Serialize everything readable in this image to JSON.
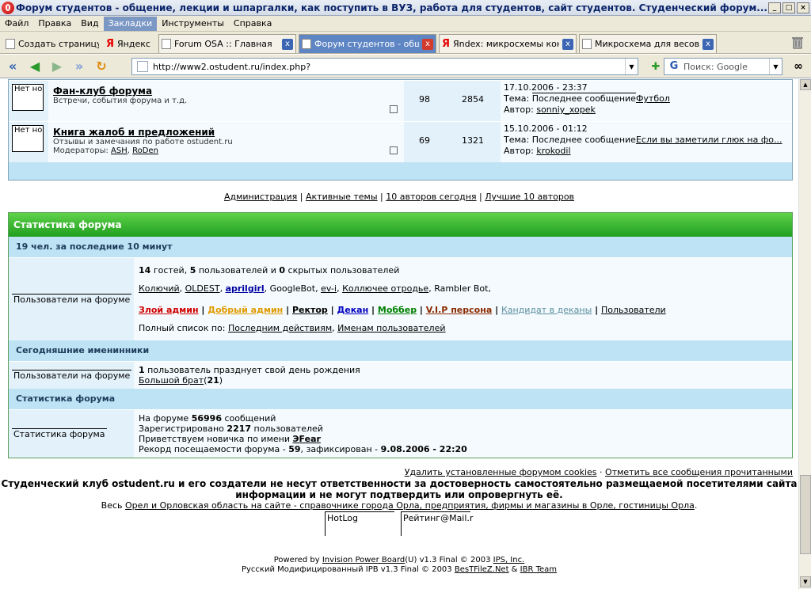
{
  "window": {
    "title": "Форум студентов - общение, лекции и шпаргалки, как поступить в ВУЗ, работа для студентов, сайт студентов. Студенческий форум... - Opera"
  },
  "menu": [
    "Файл",
    "Правка",
    "Вид",
    "Закладки",
    "Инструменты",
    "Справка"
  ],
  "tabs": [
    {
      "label": "Создать страницу",
      "kind": "page"
    },
    {
      "label": "Яндекс",
      "kind": "yandex"
    },
    {
      "label": "Forum OSA :: Главная",
      "kind": "doc"
    },
    {
      "label": "Форум студентов - общ...",
      "kind": "doc",
      "active": true
    },
    {
      "label": "Яndex: микросхемы кон...",
      "kind": "yandex"
    },
    {
      "label": "Микросхема для весов ...",
      "kind": "doc"
    }
  ],
  "address": {
    "url": "http://www2.ostudent.ru/index.php?"
  },
  "search": {
    "placeholder": "Поиск: Google"
  },
  "forums": [
    {
      "no": "Нет но",
      "title": "Фан-клуб форума",
      "desc": "Встречи, события форума и т.д.",
      "mods_label": "",
      "mods": [],
      "topics": "98",
      "posts": "2854",
      "date": "17.10.2006 - 23:37",
      "tema_label": "Тема:",
      "last_label": "Последнее сообщение",
      "topic": "Футбол",
      "author_label": "Автор:",
      "author": "sonniy_xopek"
    },
    {
      "no": "Нет но",
      "title": "Книга жалоб и предложений",
      "desc": "Отзывы и замечания по работе ostudent.ru",
      "mods_label": "Модераторы:",
      "mods": [
        "ASH",
        "RoDen"
      ],
      "topics": "69",
      "posts": "1321",
      "date": "15.10.2006 - 01:12",
      "tema_label": "Тема:",
      "last_label": "Последнее сообщение",
      "topic": "Если вы заметили глюк на фо...",
      "author_label": "Автор:",
      "author": "krokodil"
    }
  ],
  "toplinks": [
    "Администрация",
    "Активные темы",
    "10 авторов сегодня",
    "Лучшие 10 авторов"
  ],
  "stats": {
    "header": "Статистика форума",
    "online_head": "19 чел. за последние 10 минут",
    "online_label": "Пользователи на форуме",
    "guests": "14",
    "guests_t": "гостей,",
    "users": "5",
    "users_t": "пользователей и",
    "hidden": "0",
    "hidden_t": "скрытых пользователей",
    "online_users": [
      "Колючий",
      "OLDEST",
      "aprilgirl",
      "GoogleBot",
      "ev-i",
      "Коллючее отродье",
      "Rambler Bot"
    ],
    "groups": [
      {
        "name": "Злой админ",
        "color": "#d00000"
      },
      {
        "name": "Добрый админ",
        "color": "#e09a00"
      },
      {
        "name": "Ректор",
        "color": "#000000"
      },
      {
        "name": "Декан",
        "color": "#0000c0"
      },
      {
        "name": "Моббер",
        "color": "#008000"
      },
      {
        "name": "V.I.P персона",
        "color": "#8b2a00"
      },
      {
        "name": "Кандидат в деканы",
        "color": "#5a8ea0"
      },
      {
        "name": "Пользователи",
        "color": "#000000"
      }
    ],
    "fulllist": "Полный список по:",
    "by_action": "Последним действиям",
    "by_name": "Именам пользователей",
    "bday_head": "Сегодняшние именинники",
    "bday_label": "Пользователи на форуме",
    "bday_count": "1",
    "bday_text": "пользователь празднует свой день рождения",
    "bday_user": "Большой брат",
    "bday_age": "21",
    "stat_head": "Статистика форума",
    "stat_label": "Статистика форума",
    "msgs_pre": "На форуме",
    "msgs": "56996",
    "msgs_post": "сообщений",
    "reg_pre": "Зарегистрировано",
    "reg": "2217",
    "reg_post": "пользователей",
    "new_pre": "Приветствуем новичка по имени",
    "new_user": "ЭFear",
    "rec_pre": "Рекорд посещаемости форума -",
    "rec": "59",
    "rec_mid": ", зафиксирован -",
    "rec_date": "9.08.2006 - 22:20"
  },
  "footer": {
    "del_cookies": "Удалить установленные форумом cookies",
    "mark_read": "Отметить все сообщения прочитанными",
    "disclaimer": "Студенческий клуб ostudent.ru и его создатели не несут ответственности за достоверность самостоятельно размещаемой посетителями сайта информации и не могут подтвердить или опровергнуть её.",
    "orel_pre": "Весь",
    "orel_link": "Орел и Орловская область на сайте - справочнике города Орла, предприятия, фирмы и магазины в Орле, гостиницы Орла",
    "counter1": "HotLog",
    "counter2": "Рейтинг@Mail.r",
    "powered_pre": "Powered by",
    "ipb": "Invision Power Board",
    "powered_mid": "(U) v1.3 Final © 2003",
    "ips": "IPS, Inc.",
    "ru_pre": "Русский Модифицированный IPB v1.3 Final © 2003",
    "bestfilez": "BesTFileZ.Net",
    "ibr": "IBR Team"
  }
}
